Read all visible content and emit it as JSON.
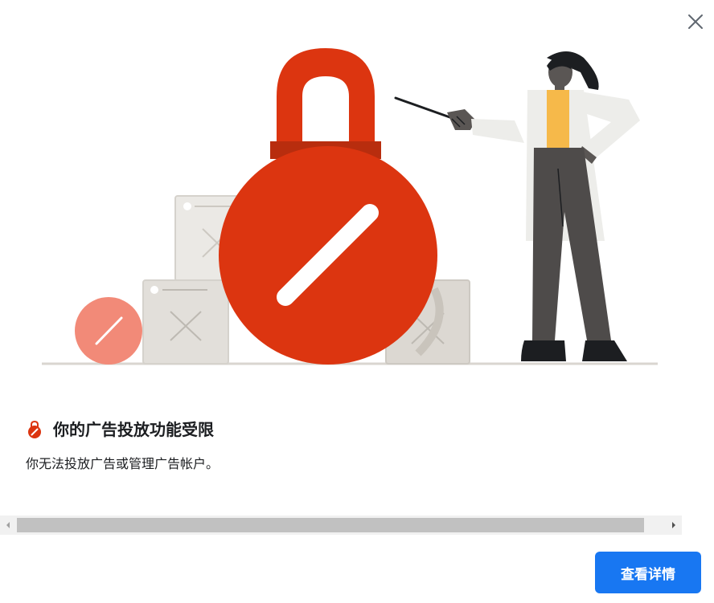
{
  "dialog": {
    "close_icon": "close-icon",
    "warning_icon": "lock-icon",
    "title": "你的广告投放功能受限",
    "description": "你无法投放广告或管理广告帐户。",
    "primary_button": "查看详情"
  },
  "scrollbar": {
    "left_arrow": "left-arrow-icon",
    "right_arrow": "right-arrow-icon"
  },
  "colors": {
    "accent": "#1877f2",
    "lock_red": "#dc3510",
    "soft_red": "#f28a78"
  }
}
